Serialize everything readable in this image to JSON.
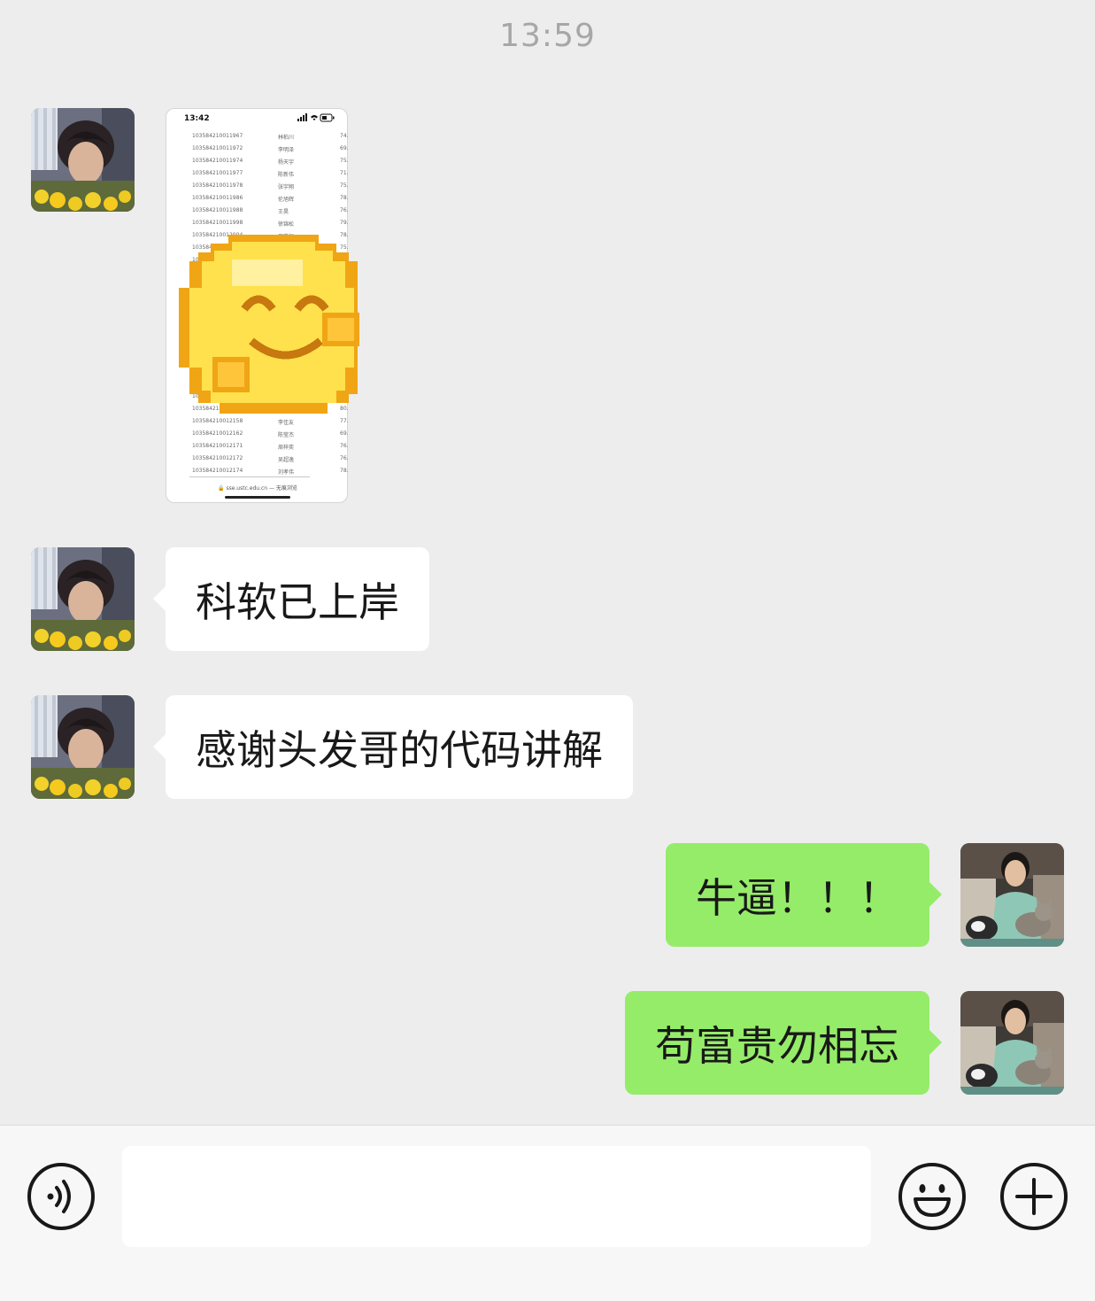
{
  "timestamp": "13:59",
  "image_message": {
    "status_time": "13:42",
    "rows": [
      {
        "id": "103584210011967",
        "name": "林柏川",
        "score": "74."
      },
      {
        "id": "103584210011972",
        "name": "李明泽",
        "score": "69."
      },
      {
        "id": "103584210011974",
        "name": "杨天宇",
        "score": "75."
      },
      {
        "id": "103584210011977",
        "name": "陈新伟",
        "score": "71."
      },
      {
        "id": "103584210011978",
        "name": "张宇翔",
        "score": "75."
      },
      {
        "id": "103584210011986",
        "name": "伦旭辉",
        "score": "78."
      },
      {
        "id": "103584210011988",
        "name": "王昊",
        "score": "76."
      },
      {
        "id": "103584210011998",
        "name": "徐锦松",
        "score": "79."
      },
      {
        "id": "103584210012004",
        "name": "周荣恒",
        "score": "78."
      },
      {
        "id": "10358421001",
        "name": "",
        "score": "75."
      },
      {
        "id": "1035",
        "name": "",
        "score": "73."
      },
      {
        "id": "1035",
        "name": "",
        "score": "77."
      },
      {
        "id": "",
        "name": "",
        "score": ""
      },
      {
        "id": "",
        "name": "",
        "score": ""
      },
      {
        "id": "",
        "name": "",
        "score": ""
      },
      {
        "id": "",
        "name": "",
        "score": ""
      },
      {
        "id": "",
        "name": "",
        "score": ""
      },
      {
        "id": "",
        "name": "",
        "score": ""
      },
      {
        "id": "",
        "name": "",
        "score": ""
      },
      {
        "id": "",
        "name": "",
        "score": ""
      },
      {
        "id": "10",
        "name": "",
        "score": "77."
      },
      {
        "id": "1035842",
        "name": "",
        "score": "83."
      },
      {
        "id": "103584210012",
        "name": "",
        "score": "80."
      },
      {
        "id": "103584210012158",
        "name": "李佳友",
        "score": "77."
      },
      {
        "id": "103584210012162",
        "name": "陈莹杰",
        "score": "69."
      },
      {
        "id": "103584210012171",
        "name": "周梓奕",
        "score": "76."
      },
      {
        "id": "103584210012172",
        "name": "吴超逸",
        "score": "76."
      },
      {
        "id": "103584210012174",
        "name": "刘孝伟",
        "score": "78."
      }
    ],
    "footer": "🔒 sse.ustc.edu.cn — 无痕浏览"
  },
  "messages": [
    {
      "side": "left",
      "text": "科软已上岸"
    },
    {
      "side": "left",
      "text": "感谢头发哥的代码讲解"
    },
    {
      "side": "right",
      "text": "牛逼！！！"
    },
    {
      "side": "right",
      "text": "苟富贵勿相忘"
    }
  ],
  "input_bar": {
    "value": "",
    "voice_icon": "voice-icon",
    "emoji_icon": "smiley-icon",
    "more_icon": "plus-icon"
  },
  "colors": {
    "background": "#ededed",
    "bubble_self": "#95ec69",
    "bubble_other": "#ffffff"
  }
}
